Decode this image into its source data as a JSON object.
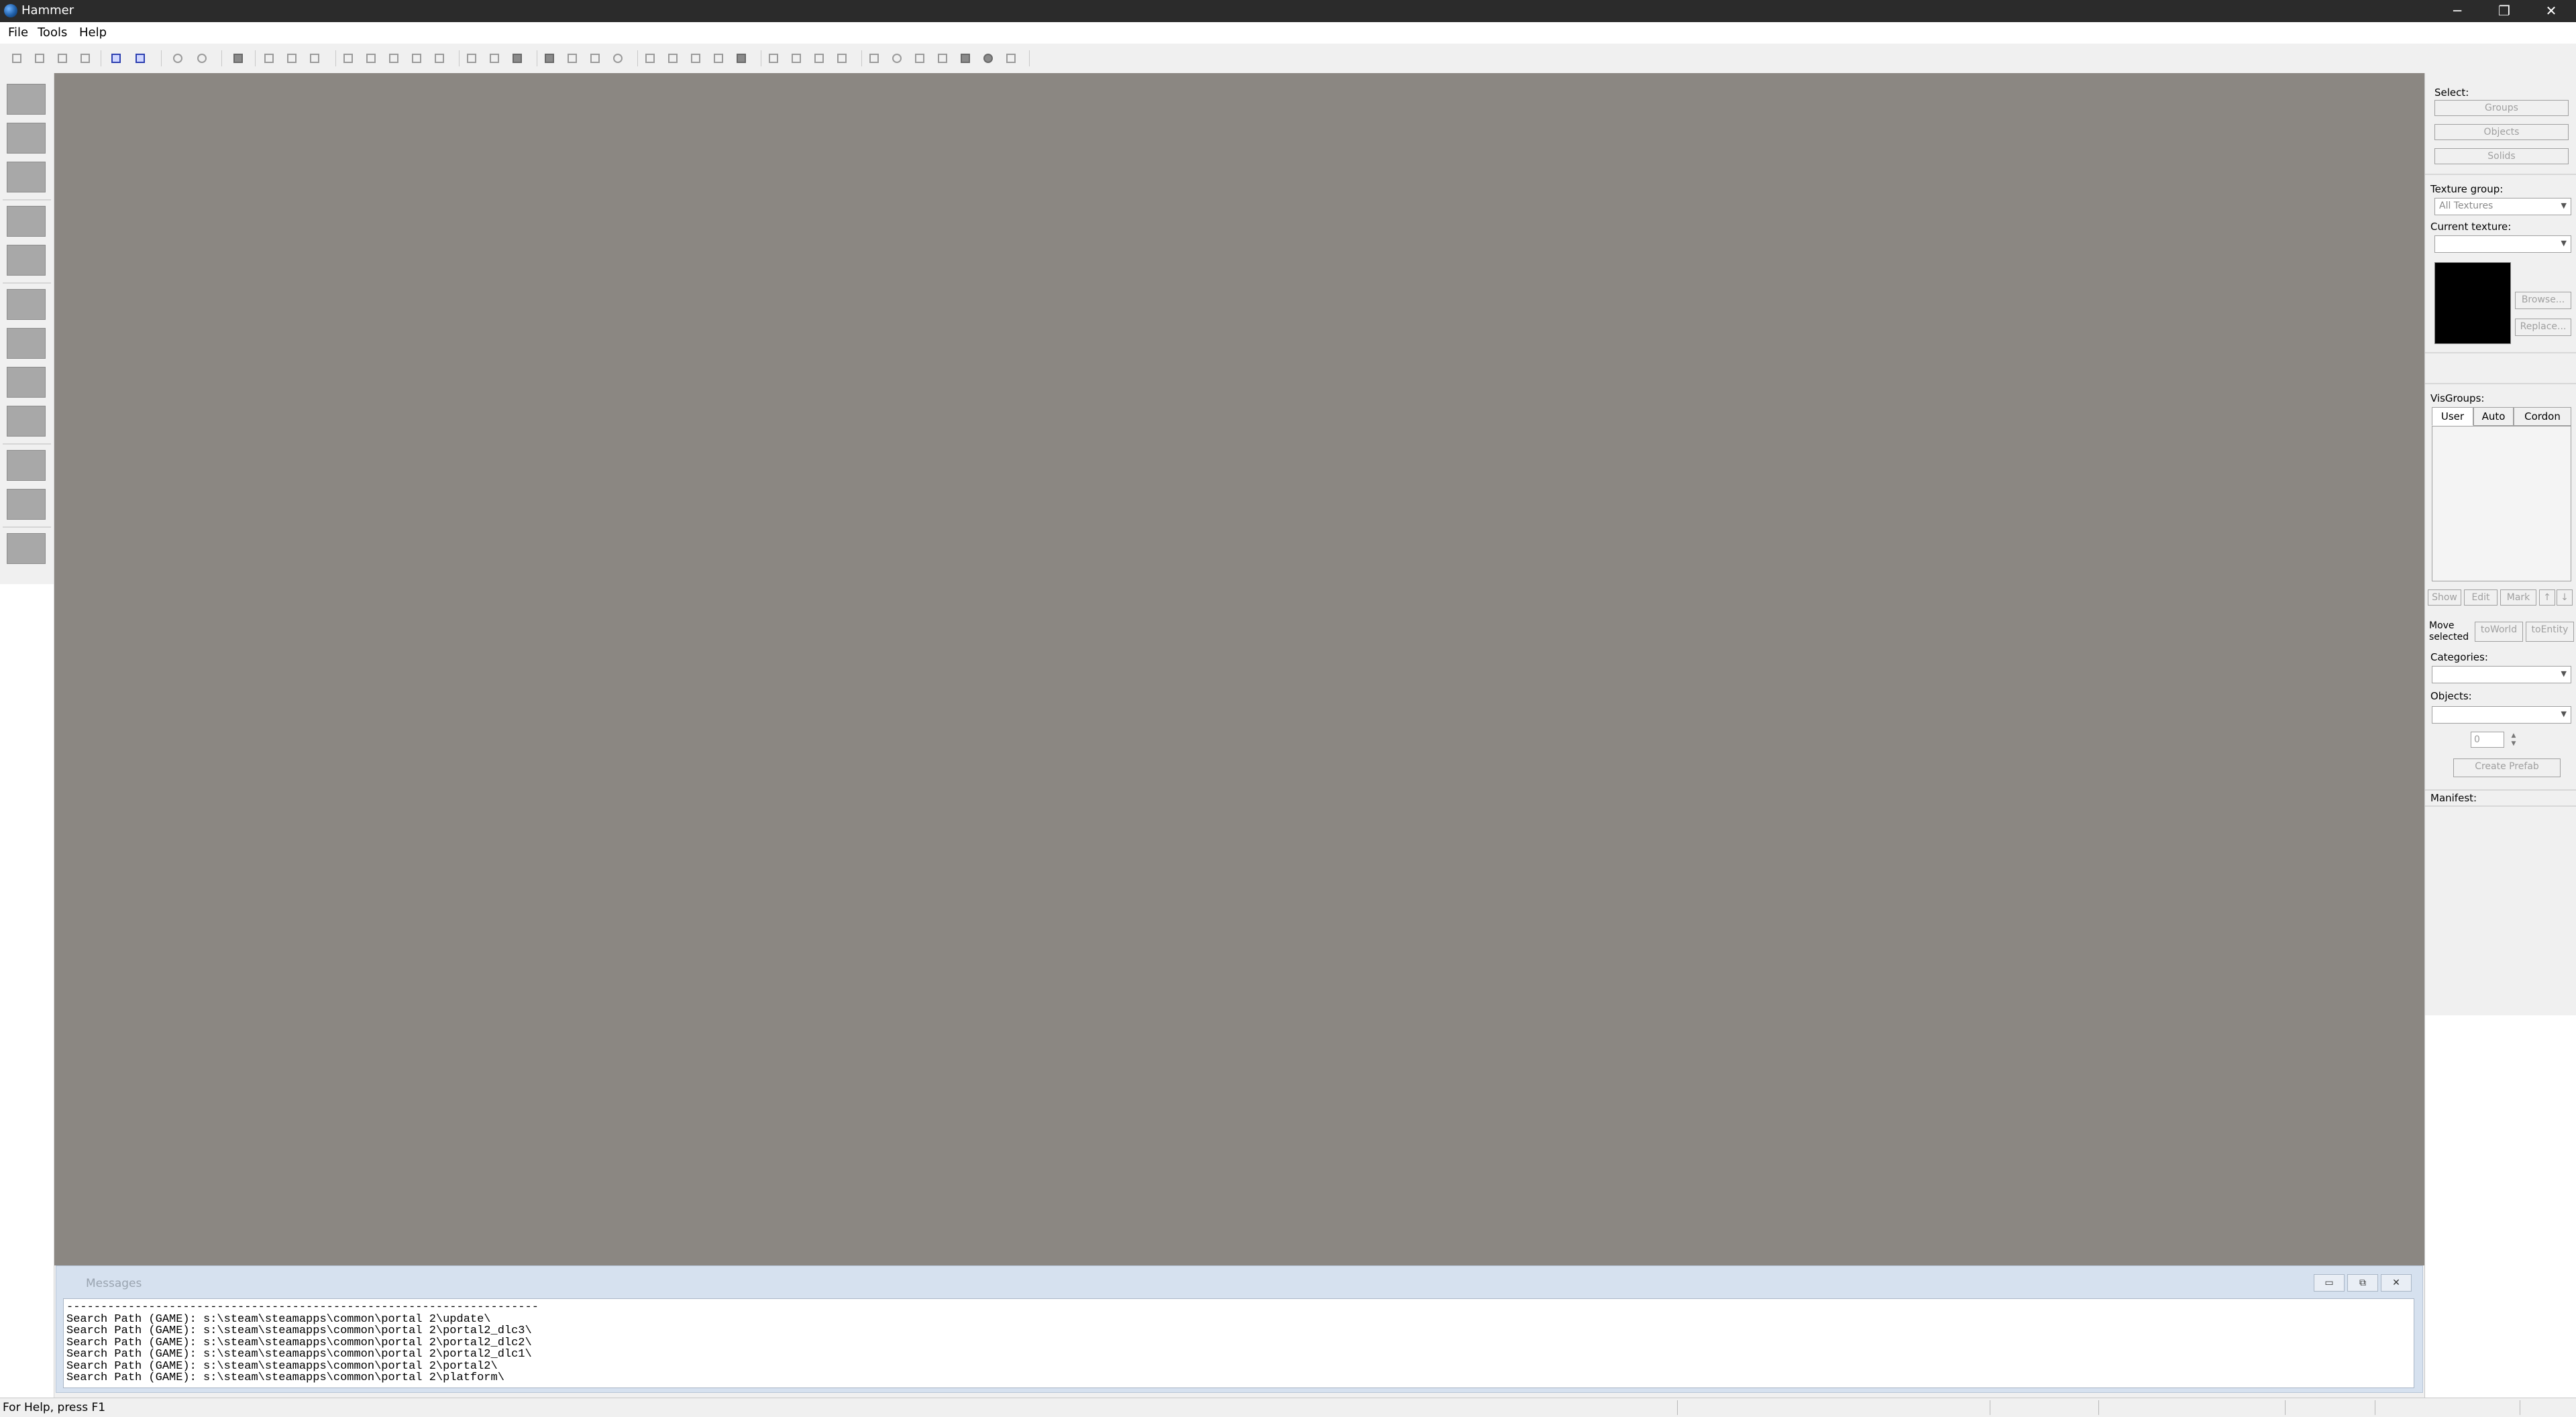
{
  "window": {
    "title": "Hammer",
    "controls": {
      "minimize": "─",
      "maximize": "❐",
      "close": "✕"
    }
  },
  "menu": {
    "items": [
      "File",
      "Tools",
      "Help"
    ]
  },
  "toolbar": {
    "icons": [
      "grid-icon",
      "grid-toggle-icon",
      "grid-smaller-icon",
      "grid-larger-icon",
      "carve-icon",
      "carve-alt-icon",
      "undo-icon",
      "redo-icon",
      "group-icon",
      "ungroup-icon",
      "hide-icon",
      "unhide-icon",
      "quickhide-icon",
      "cut-icon",
      "copy-icon",
      "paste-icon",
      "select-icon",
      "resize-icon",
      "rotate-icon",
      "vertex-icon",
      "clip-icon",
      "flip-icon",
      "align-icon",
      "terrain-icon",
      "cordon-icon",
      "lighting-icon",
      "compile-icon"
    ]
  },
  "viewport": {
    "background": "#8b8782"
  },
  "messages": {
    "title": "Messages",
    "controls": {
      "minimize": "▭",
      "restore": "⧉",
      "close": "✕"
    },
    "log": "---------------------------------------------------------------------\nSearch Path (GAME): s:\\steam\\steamapps\\common\\portal 2\\update\\\nSearch Path (GAME): s:\\steam\\steamapps\\common\\portal 2\\portal2_dlc3\\\nSearch Path (GAME): s:\\steam\\steamapps\\common\\portal 2\\portal2_dlc2\\\nSearch Path (GAME): s:\\steam\\steamapps\\common\\portal 2\\portal2_dlc1\\\nSearch Path (GAME): s:\\steam\\steamapps\\common\\portal 2\\portal2\\\nSearch Path (GAME): s:\\steam\\steamapps\\common\\portal 2\\platform\\"
  },
  "right_panel": {
    "select_label": "Select:",
    "groups": "Groups",
    "objects_btn": "Objects",
    "solids": "Solids",
    "texture_group_label": "Texture group:",
    "texture_group_value": "All Textures",
    "current_texture_label": "Current texture:",
    "current_texture_value": "",
    "browse": "Browse...",
    "replace": "Replace...",
    "visgroups_label": "VisGroups:",
    "tabs": [
      "User",
      "Auto",
      "Cordon"
    ],
    "show": "Show",
    "edit": "Edit",
    "mark": "Mark",
    "up": "↑",
    "down": "↓",
    "move_selected": "Move selected",
    "to_world": "toWorld",
    "to_entity": "toEntity",
    "categories_label": "Categories:",
    "objects_label": "Objects:",
    "stepper_value": "0",
    "create_prefab": "Create Prefab",
    "manifest_label": "Manifest:"
  },
  "status": {
    "help": "For Help, press F1"
  }
}
